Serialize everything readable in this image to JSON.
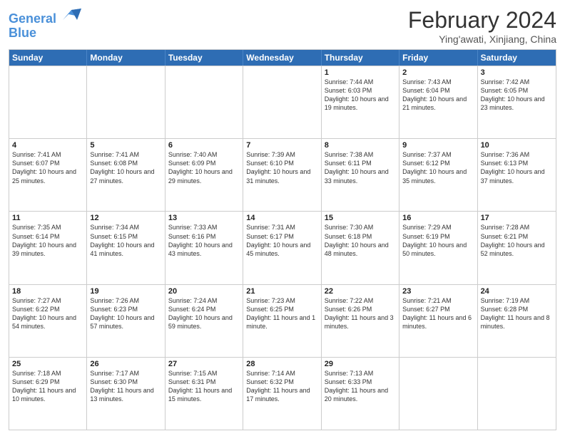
{
  "header": {
    "logo_line1": "General",
    "logo_line2": "Blue",
    "month_title": "February 2024",
    "location": "Ying'awati, Xinjiang, China"
  },
  "weekdays": [
    "Sunday",
    "Monday",
    "Tuesday",
    "Wednesday",
    "Thursday",
    "Friday",
    "Saturday"
  ],
  "weeks": [
    [
      {
        "day": "",
        "info": ""
      },
      {
        "day": "",
        "info": ""
      },
      {
        "day": "",
        "info": ""
      },
      {
        "day": "",
        "info": ""
      },
      {
        "day": "1",
        "info": "Sunrise: 7:44 AM\nSunset: 6:03 PM\nDaylight: 10 hours and 19 minutes."
      },
      {
        "day": "2",
        "info": "Sunrise: 7:43 AM\nSunset: 6:04 PM\nDaylight: 10 hours and 21 minutes."
      },
      {
        "day": "3",
        "info": "Sunrise: 7:42 AM\nSunset: 6:05 PM\nDaylight: 10 hours and 23 minutes."
      }
    ],
    [
      {
        "day": "4",
        "info": "Sunrise: 7:41 AM\nSunset: 6:07 PM\nDaylight: 10 hours and 25 minutes."
      },
      {
        "day": "5",
        "info": "Sunrise: 7:41 AM\nSunset: 6:08 PM\nDaylight: 10 hours and 27 minutes."
      },
      {
        "day": "6",
        "info": "Sunrise: 7:40 AM\nSunset: 6:09 PM\nDaylight: 10 hours and 29 minutes."
      },
      {
        "day": "7",
        "info": "Sunrise: 7:39 AM\nSunset: 6:10 PM\nDaylight: 10 hours and 31 minutes."
      },
      {
        "day": "8",
        "info": "Sunrise: 7:38 AM\nSunset: 6:11 PM\nDaylight: 10 hours and 33 minutes."
      },
      {
        "day": "9",
        "info": "Sunrise: 7:37 AM\nSunset: 6:12 PM\nDaylight: 10 hours and 35 minutes."
      },
      {
        "day": "10",
        "info": "Sunrise: 7:36 AM\nSunset: 6:13 PM\nDaylight: 10 hours and 37 minutes."
      }
    ],
    [
      {
        "day": "11",
        "info": "Sunrise: 7:35 AM\nSunset: 6:14 PM\nDaylight: 10 hours and 39 minutes."
      },
      {
        "day": "12",
        "info": "Sunrise: 7:34 AM\nSunset: 6:15 PM\nDaylight: 10 hours and 41 minutes."
      },
      {
        "day": "13",
        "info": "Sunrise: 7:33 AM\nSunset: 6:16 PM\nDaylight: 10 hours and 43 minutes."
      },
      {
        "day": "14",
        "info": "Sunrise: 7:31 AM\nSunset: 6:17 PM\nDaylight: 10 hours and 45 minutes."
      },
      {
        "day": "15",
        "info": "Sunrise: 7:30 AM\nSunset: 6:18 PM\nDaylight: 10 hours and 48 minutes."
      },
      {
        "day": "16",
        "info": "Sunrise: 7:29 AM\nSunset: 6:19 PM\nDaylight: 10 hours and 50 minutes."
      },
      {
        "day": "17",
        "info": "Sunrise: 7:28 AM\nSunset: 6:21 PM\nDaylight: 10 hours and 52 minutes."
      }
    ],
    [
      {
        "day": "18",
        "info": "Sunrise: 7:27 AM\nSunset: 6:22 PM\nDaylight: 10 hours and 54 minutes."
      },
      {
        "day": "19",
        "info": "Sunrise: 7:26 AM\nSunset: 6:23 PM\nDaylight: 10 hours and 57 minutes."
      },
      {
        "day": "20",
        "info": "Sunrise: 7:24 AM\nSunset: 6:24 PM\nDaylight: 10 hours and 59 minutes."
      },
      {
        "day": "21",
        "info": "Sunrise: 7:23 AM\nSunset: 6:25 PM\nDaylight: 11 hours and 1 minute."
      },
      {
        "day": "22",
        "info": "Sunrise: 7:22 AM\nSunset: 6:26 PM\nDaylight: 11 hours and 3 minutes."
      },
      {
        "day": "23",
        "info": "Sunrise: 7:21 AM\nSunset: 6:27 PM\nDaylight: 11 hours and 6 minutes."
      },
      {
        "day": "24",
        "info": "Sunrise: 7:19 AM\nSunset: 6:28 PM\nDaylight: 11 hours and 8 minutes."
      }
    ],
    [
      {
        "day": "25",
        "info": "Sunrise: 7:18 AM\nSunset: 6:29 PM\nDaylight: 11 hours and 10 minutes."
      },
      {
        "day": "26",
        "info": "Sunrise: 7:17 AM\nSunset: 6:30 PM\nDaylight: 11 hours and 13 minutes."
      },
      {
        "day": "27",
        "info": "Sunrise: 7:15 AM\nSunset: 6:31 PM\nDaylight: 11 hours and 15 minutes."
      },
      {
        "day": "28",
        "info": "Sunrise: 7:14 AM\nSunset: 6:32 PM\nDaylight: 11 hours and 17 minutes."
      },
      {
        "day": "29",
        "info": "Sunrise: 7:13 AM\nSunset: 6:33 PM\nDaylight: 11 hours and 20 minutes."
      },
      {
        "day": "",
        "info": ""
      },
      {
        "day": "",
        "info": ""
      }
    ]
  ]
}
